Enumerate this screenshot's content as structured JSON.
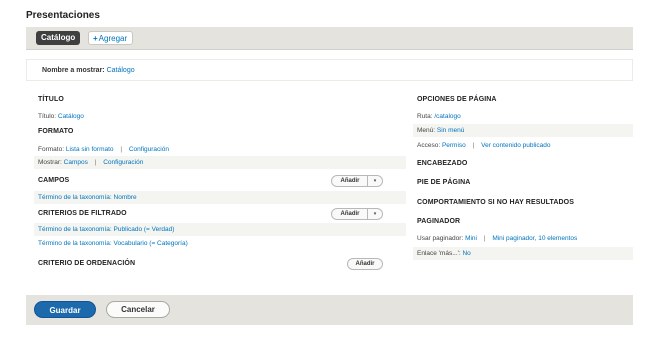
{
  "page": {
    "title": "Presentaciones"
  },
  "tabs": {
    "catalog": "Catálogo",
    "add_icon": "+",
    "add": "Agregar"
  },
  "display_name": {
    "label": "Nombre a mostrar:",
    "value": "Catálogo"
  },
  "left": {
    "title": {
      "heading": "Título",
      "label": "Título:",
      "value": "Catálogo"
    },
    "format": {
      "heading": "Formato",
      "format_label": "Formato:",
      "format_value": "Lista sin formato",
      "format_config": "Configuración",
      "show_label": "Mostrar:",
      "show_value": "Campos",
      "show_config": "Configuración"
    },
    "fields": {
      "heading": "Campos",
      "add_button": "Añadir",
      "items": [
        "Término de la taxonomía: Nombre"
      ]
    },
    "filters": {
      "heading": "Criterios de filtrado",
      "add_button": "Añadir",
      "items": [
        "Término de la taxonomía: Publicado (= Verdad)",
        "Término de la taxonomía: Vocabulario (= Categoría)"
      ]
    },
    "sort": {
      "heading": "Criterio de ordenación",
      "add_button": "Añadir"
    }
  },
  "right": {
    "page_options": {
      "heading": "Opciones de página",
      "path_label": "Ruta:",
      "path_value": "/catalogo",
      "menu_label": "Menú:",
      "menu_value": "Sin menú",
      "access_label": "Acceso:",
      "access_value": "Permiso",
      "access_value2": "Ver contenido publicado"
    },
    "header_heading": "Encabezado",
    "footer_heading": "Pie de página",
    "no_results_heading": "Comportamiento si no hay resultados",
    "pager": {
      "heading": "Paginador",
      "use_label": "Usar paginador:",
      "use_value": "Mini",
      "use_value2": "Mini paginador, 10 elementos",
      "more_label": "Enlace 'más...':",
      "more_value": "No"
    }
  },
  "actions": {
    "save": "Guardar",
    "cancel": "Cancelar"
  },
  "dropdown_arrow": "▾",
  "separator": "|"
}
